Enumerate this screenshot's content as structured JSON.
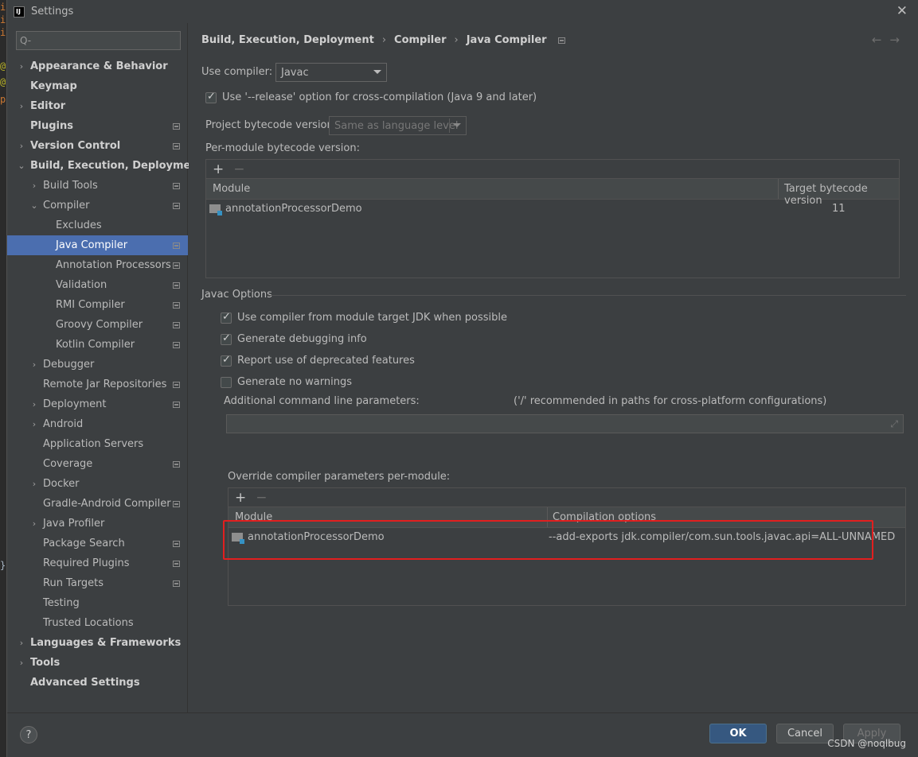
{
  "window": {
    "title": "Settings",
    "logo": "IJ"
  },
  "search": {
    "placeholder": "Q-"
  },
  "tree": [
    {
      "label": "Appearance & Behavior",
      "bold": true,
      "chev": "›",
      "pin": false
    },
    {
      "label": "Keymap",
      "bold": true,
      "chev": "",
      "pin": false
    },
    {
      "label": "Editor",
      "bold": true,
      "chev": "›",
      "pin": false
    },
    {
      "label": "Plugins",
      "bold": true,
      "chev": "",
      "pin": true
    },
    {
      "label": "Version Control",
      "bold": true,
      "chev": "›",
      "pin": true
    },
    {
      "label": "Build, Execution, Deployment",
      "bold": true,
      "chev": "⌄",
      "pin": false
    },
    {
      "label": "Build Tools",
      "bold": false,
      "chev": "›",
      "pin": true
    },
    {
      "label": "Compiler",
      "bold": false,
      "chev": "⌄",
      "pin": true
    },
    {
      "label": "Excludes",
      "bold": false,
      "chev": "",
      "pin": false
    },
    {
      "label": "Java Compiler",
      "bold": false,
      "chev": "",
      "pin": true,
      "selected": true
    },
    {
      "label": "Annotation Processors",
      "bold": false,
      "chev": "",
      "pin": true
    },
    {
      "label": "Validation",
      "bold": false,
      "chev": "",
      "pin": true
    },
    {
      "label": "RMI Compiler",
      "bold": false,
      "chev": "",
      "pin": true
    },
    {
      "label": "Groovy Compiler",
      "bold": false,
      "chev": "",
      "pin": true
    },
    {
      "label": "Kotlin Compiler",
      "bold": false,
      "chev": "",
      "pin": true
    },
    {
      "label": "Debugger",
      "bold": false,
      "chev": "›",
      "pin": false
    },
    {
      "label": "Remote Jar Repositories",
      "bold": false,
      "chev": "",
      "pin": true
    },
    {
      "label": "Deployment",
      "bold": false,
      "chev": "›",
      "pin": true
    },
    {
      "label": "Android",
      "bold": false,
      "chev": "›",
      "pin": false
    },
    {
      "label": "Application Servers",
      "bold": false,
      "chev": "",
      "pin": false
    },
    {
      "label": "Coverage",
      "bold": false,
      "chev": "",
      "pin": true
    },
    {
      "label": "Docker",
      "bold": false,
      "chev": "›",
      "pin": false
    },
    {
      "label": "Gradle-Android Compiler",
      "bold": false,
      "chev": "",
      "pin": true
    },
    {
      "label": "Java Profiler",
      "bold": false,
      "chev": "›",
      "pin": false
    },
    {
      "label": "Package Search",
      "bold": false,
      "chev": "",
      "pin": true
    },
    {
      "label": "Required Plugins",
      "bold": false,
      "chev": "",
      "pin": true
    },
    {
      "label": "Run Targets",
      "bold": false,
      "chev": "",
      "pin": true
    },
    {
      "label": "Testing",
      "bold": false,
      "chev": "",
      "pin": false
    },
    {
      "label": "Trusted Locations",
      "bold": false,
      "chev": "",
      "pin": false
    },
    {
      "label": "Languages & Frameworks",
      "bold": true,
      "chev": "›",
      "pin": false
    },
    {
      "label": "Tools",
      "bold": true,
      "chev": "›",
      "pin": false
    },
    {
      "label": "Advanced Settings",
      "bold": true,
      "chev": "",
      "pin": false
    }
  ],
  "breadcrumb": {
    "part1": "Build, Execution, Deployment",
    "part2": "Compiler",
    "part3": "Java Compiler",
    "sep": "›"
  },
  "nav": {
    "back": "←",
    "forward": "→"
  },
  "compiler": {
    "use_compiler_label": "Use compiler:",
    "use_compiler_value": "Javac",
    "release_option": "Use '--release' option for cross-compilation (Java 9 and later)",
    "bytecode_label": "Project bytecode version:",
    "bytecode_value": "Same as language level",
    "per_module_label": "Per-module bytecode version:",
    "per_module_table": {
      "col_module": "Module",
      "col_target": "Target bytecode version",
      "rows": [
        {
          "module": "annotationProcessorDemo",
          "target": "11"
        }
      ]
    }
  },
  "javac": {
    "section_title": "Javac Options",
    "opt1": "Use compiler from module target JDK when possible",
    "opt2": "Generate debugging info",
    "opt3": "Report use of deprecated features",
    "opt4": "Generate no warnings",
    "additional_label": "Additional command line parameters:",
    "additional_hint": "('/' recommended in paths for cross-platform configurations)",
    "additional_value": "",
    "override_label": "Override compiler parameters per-module:",
    "override_table": {
      "col_module": "Module",
      "col_options": "Compilation options",
      "rows": [
        {
          "module": "annotationProcessorDemo",
          "options": "--add-exports jdk.compiler/com.sun.tools.javac.api=ALL-UNNAMED"
        }
      ]
    }
  },
  "toolbar_icons": {
    "add": "+",
    "remove": "−"
  },
  "footer": {
    "help": "?",
    "ok": "OK",
    "cancel": "Cancel",
    "apply": "Apply",
    "watermark": "CSDN @noqlbug"
  },
  "editor_gutter": [
    "i",
    "i",
    "i",
    "@",
    "@",
    "p",
    "}"
  ],
  "colors": {
    "selection": "#4b6eaf",
    "primary_button": "#365880",
    "highlight_box": "#e11f1f"
  }
}
